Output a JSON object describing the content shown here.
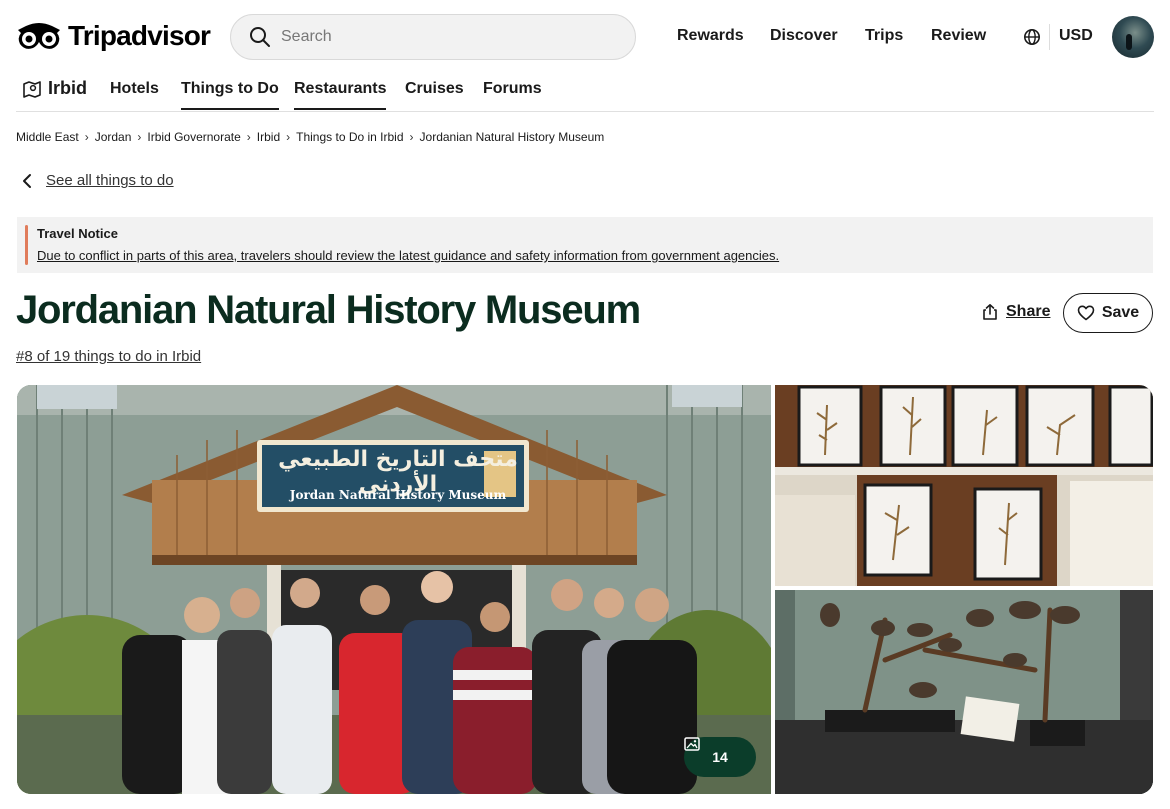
{
  "header": {
    "brand": "Tripadvisor",
    "search": {
      "placeholder": "Search",
      "value": ""
    },
    "nav": [
      "Rewards",
      "Discover",
      "Trips",
      "Review"
    ],
    "currency": "USD"
  },
  "subnav": {
    "city": "Irbid",
    "items": [
      {
        "label": "Hotels",
        "active": false
      },
      {
        "label": "Things to Do",
        "active": true
      },
      {
        "label": "Restaurants",
        "active": true
      },
      {
        "label": "Cruises",
        "active": false
      },
      {
        "label": "Forums",
        "active": false
      }
    ]
  },
  "breadcrumb": [
    "Middle East",
    "Jordan",
    "Irbid Governorate",
    "Irbid",
    "Things to Do in Irbid",
    "Jordanian Natural History Museum"
  ],
  "back_link": "See all things to do",
  "notice": {
    "title": "Travel Notice",
    "body": "Due to conflict in parts of this area, travelers should review the latest guidance and safety information from government agencies."
  },
  "attraction": {
    "title": "Jordanian Natural History Museum",
    "rank": "#8 of 19 things to do in Irbid",
    "share_label": "Share",
    "save_label": "Save"
  },
  "gallery": {
    "photo_count": "14",
    "sign_arabic": "متحف التاريخ الطبيعي الأردني",
    "sign_english": "Jordan Natural History Museum"
  },
  "colors": {
    "brand_dark_green": "#0b3d2a",
    "title_green": "#0b2c1f",
    "notice_accent": "#e07c5b",
    "notice_bg": "#f2f2f2"
  },
  "icons": [
    "tripadvisor-owl-icon",
    "search-icon",
    "globe-icon",
    "map-icon",
    "chevron-left-icon",
    "share-icon",
    "heart-icon",
    "photo-icon"
  ]
}
